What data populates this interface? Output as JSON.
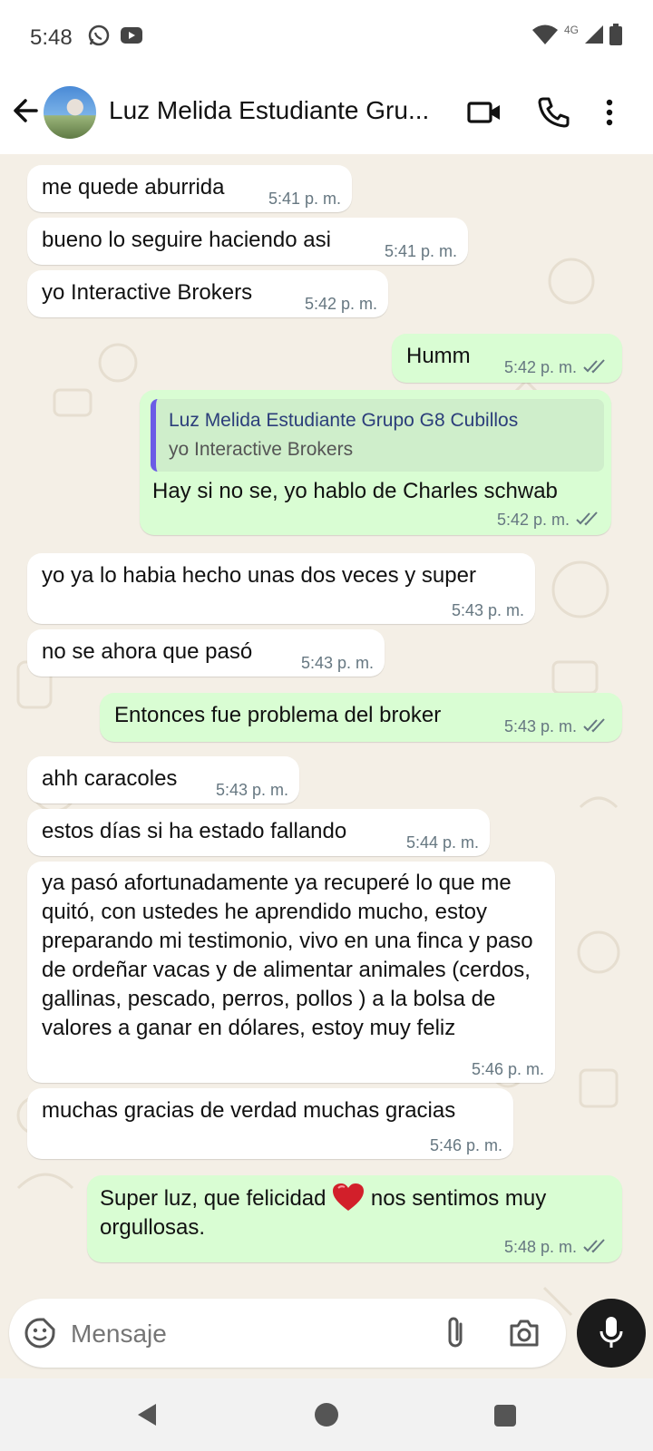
{
  "status_bar": {
    "time": "5:48",
    "network": "4G"
  },
  "header": {
    "contact_name": "Luz Melida Estudiante Gru..."
  },
  "messages": [
    {
      "text": "me quede aburrida",
      "time": "5:41 p. m."
    },
    {
      "text": "bueno lo seguire haciendo asi",
      "time": "5:41 p. m."
    },
    {
      "text": "yo Interactive Brokers",
      "time": "5:42 p. m."
    },
    {
      "text": "Humm",
      "time": "5:42 p. m."
    },
    {
      "quote_author": "Luz Melida Estudiante Grupo G8 Cubillos",
      "quote_text": "yo Interactive Brokers",
      "text": "Hay si no se, yo hablo de Charles schwab",
      "time": "5:42 p. m."
    },
    {
      "text": "yo ya lo habia hecho unas dos veces y super",
      "time": "5:43 p. m."
    },
    {
      "text": "no se ahora que pasó",
      "time": "5:43 p. m."
    },
    {
      "text": "Entonces fue problema del broker",
      "time": "5:43 p. m."
    },
    {
      "text": "ahh caracoles",
      "time": "5:43 p. m."
    },
    {
      "text": "estos días si ha estado fallando",
      "time": "5:44 p. m."
    },
    {
      "text": "ya pasó afortunadamente ya recuperé lo que me quitó, con ustedes he aprendido mucho, estoy preparando mi testimonio, vivo en una finca y paso de ordeñar vacas y de alimentar animales (cerdos, gallinas, pescado, perros, pollos ) a la bolsa de valores a ganar en dólares, estoy muy feliz",
      "time": "5:46 p. m."
    },
    {
      "text": "muchas gracias de verdad muchas gracias",
      "time": "5:46 p. m."
    },
    {
      "text_before": "Super luz, que felicidad",
      "emoji_name": "red-heart-icon",
      "text_after": "nos sentimos muy orgullosas.",
      "time": "5:48 p. m."
    }
  ],
  "composer": {
    "placeholder": "Mensaje"
  },
  "colors": {
    "incoming_bubble": "#ffffff",
    "outgoing_bubble": "#d9fdd3",
    "wallpaper": "#f4efe6",
    "read_ticks": "#667781"
  }
}
